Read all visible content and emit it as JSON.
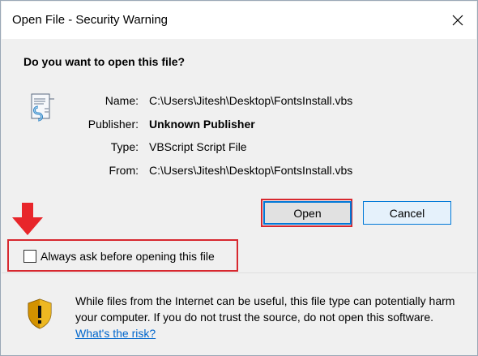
{
  "window": {
    "title": "Open File - Security Warning"
  },
  "dialog": {
    "question": "Do you want to open this file?",
    "info": [
      {
        "label": "Name:",
        "value": "C:\\Users\\Jitesh\\Desktop\\FontsInstall.vbs"
      },
      {
        "label": "Publisher:",
        "value": "Unknown Publisher"
      },
      {
        "label": "Type:",
        "value": "VBScript Script File"
      },
      {
        "label": "From:",
        "value": "C:\\Users\\Jitesh\\Desktop\\FontsInstall.vbs"
      }
    ],
    "buttons": {
      "open": "Open",
      "cancel": "Cancel"
    },
    "checkbox": {
      "label": "Always ask before opening this file",
      "checked": false
    }
  },
  "footer": {
    "warning_text": "While files from the Internet can be useful, this file type can potentially harm your computer. If you do not trust the source, do not open this software. ",
    "risk_link": "What's the risk?"
  },
  "colors": {
    "highlight": "#d7282f",
    "link": "#0066cc",
    "accent": "#0078d7"
  },
  "icons": {
    "close": "close-icon",
    "file": "script-file-icon",
    "arrow": "arrow-down-icon",
    "shield": "shield-warning-icon"
  }
}
